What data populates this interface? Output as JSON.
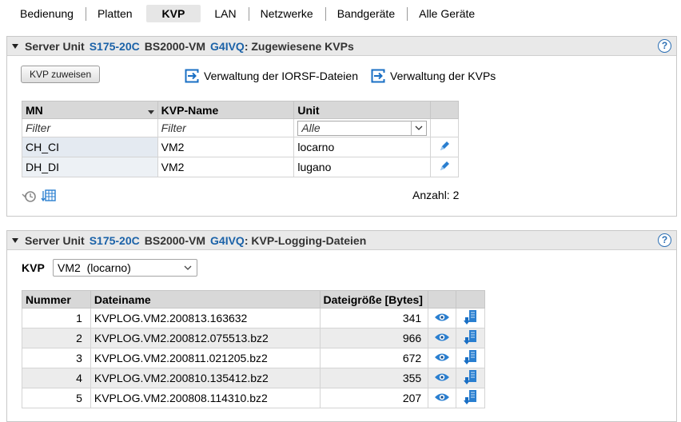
{
  "tabs": [
    {
      "label": "Bedienung",
      "active": false
    },
    {
      "label": "Platten",
      "active": false
    },
    {
      "label": "KVP",
      "active": true
    },
    {
      "label": "LAN",
      "active": false
    },
    {
      "label": "Netzwerke",
      "active": false
    },
    {
      "label": "Bandgeräte",
      "active": false
    },
    {
      "label": "Alle Geräte",
      "active": false
    }
  ],
  "panel1": {
    "title_prefix": "Server Unit",
    "server_unit": "S175-20C",
    "vm_prefix": "BS2000-VM",
    "vm": "G4IVQ",
    "title_suffix": ": Zugewiesene KVPs",
    "help": "?",
    "assign_button": "KVP zuweisen",
    "link_iorsf": "Verwaltung der IORSF-Dateien",
    "link_kvps": "Verwaltung der KVPs",
    "table": {
      "headers": {
        "mn": "MN",
        "name": "KVP-Name",
        "unit": "Unit"
      },
      "filter": {
        "mn": "Filter",
        "name": "Filter",
        "unit": "Alle"
      },
      "rows": [
        {
          "mn": "CH_CI",
          "name": "VM2",
          "unit": "locarno"
        },
        {
          "mn": "DH_DI",
          "name": "VM2",
          "unit": "lugano"
        }
      ]
    },
    "count": "Anzahl: 2"
  },
  "panel2": {
    "title_prefix": "Server Unit",
    "server_unit": "S175-20C",
    "vm_prefix": "BS2000-VM",
    "vm": "G4IVQ",
    "title_suffix": ": KVP-Logging-Dateien",
    "help": "?",
    "kvp_label": "KVP",
    "kvp_selected": "VM2  (locarno)",
    "table": {
      "headers": {
        "num": "Nummer",
        "file": "Dateiname",
        "size": "Dateigröße [Bytes]"
      },
      "rows": [
        {
          "num": "1",
          "file": "KVPLOG.VM2.200813.163632",
          "size": "341"
        },
        {
          "num": "2",
          "file": "KVPLOG.VM2.200812.075513.bz2",
          "size": "966"
        },
        {
          "num": "3",
          "file": "KVPLOG.VM2.200811.021205.bz2",
          "size": "672"
        },
        {
          "num": "4",
          "file": "KVPLOG.VM2.200810.135412.bz2",
          "size": "355"
        },
        {
          "num": "5",
          "file": "KVPLOG.VM2.200808.114310.bz2",
          "size": "207"
        }
      ]
    }
  },
  "colors": {
    "link": "#1b62a8",
    "header_bg": "#e9e9e9",
    "table_head": "#d8d8d8",
    "icon_blue": "#1a6fc4"
  }
}
